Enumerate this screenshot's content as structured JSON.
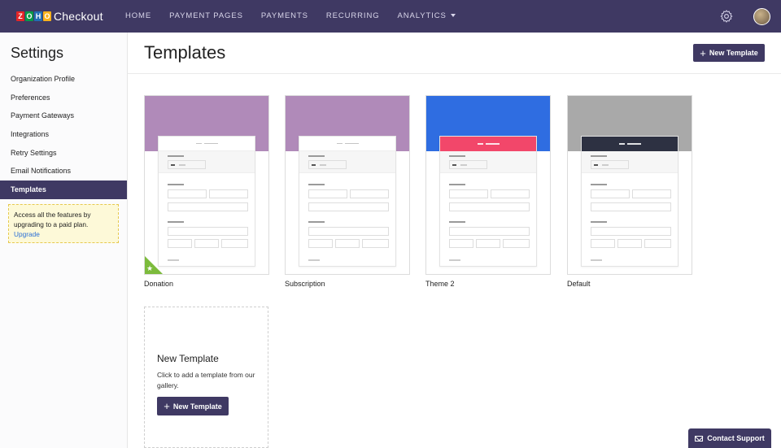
{
  "header": {
    "logo_letters": [
      "Z",
      "O",
      "H",
      "O"
    ],
    "logo_colors": [
      "#e42527",
      "#089949",
      "#226db4",
      "#f9b21d"
    ],
    "app_name": "Checkout",
    "nav": [
      "HOME",
      "PAYMENT PAGES",
      "PAYMENTS",
      "RECURRING",
      "ANALYTICS"
    ],
    "icons": [
      "gear-icon",
      "avatar"
    ]
  },
  "sidebar": {
    "title": "Settings",
    "items": [
      {
        "label": "Organization Profile",
        "active": false
      },
      {
        "label": "Preferences",
        "active": false
      },
      {
        "label": "Payment Gateways",
        "active": false
      },
      {
        "label": "Integrations",
        "active": false
      },
      {
        "label": "Retry Settings",
        "active": false
      },
      {
        "label": "Email Notifications",
        "active": false
      },
      {
        "label": "Templates",
        "active": true
      }
    ],
    "promo": {
      "text": "Access all the features by upgrading to a paid plan.",
      "link": "Upgrade"
    }
  },
  "main": {
    "title": "Templates",
    "new_button": "New Template",
    "templates": [
      {
        "name": "Donation",
        "band_color": "#b08ab9",
        "header_color": "none",
        "default": true
      },
      {
        "name": "Subscription",
        "band_color": "#b08ab9",
        "header_color": "none",
        "default": false
      },
      {
        "name": "Theme 2",
        "band_color": "#2f6de1",
        "header_color": "#f2476a",
        "default": false
      },
      {
        "name": "Default",
        "band_color": "#a9a9a9",
        "header_color": "#2d3142",
        "default": false
      }
    ],
    "new_card": {
      "title": "New Template",
      "description": "Click to add a template from our gallery.",
      "button": "New Template"
    }
  },
  "support": {
    "label": "Contact Support"
  },
  "colors": {
    "primary": "#3f3963",
    "accent_green": "#7cbb3c",
    "promo_bg": "#fdf9d8"
  }
}
